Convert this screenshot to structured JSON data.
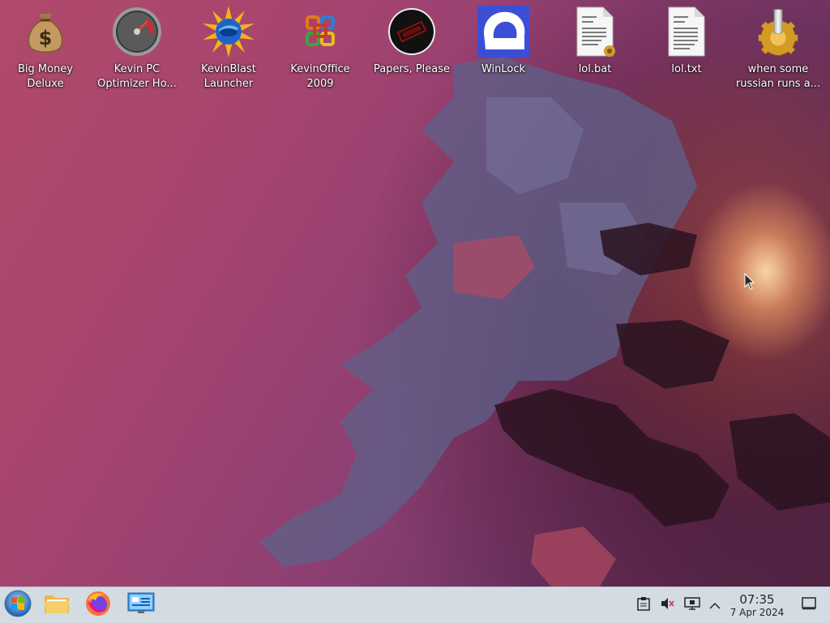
{
  "desktop": {
    "icons": [
      {
        "name": "Big Money Deluxe",
        "label": "Big Money\nDeluxe",
        "icon": "money-bag-icon"
      },
      {
        "name": "Kevin PC Optimizer Home",
        "label": "Kevin PC\nOptimizer Ho...",
        "icon": "speedometer-icon"
      },
      {
        "name": "KevinBlast Launcher",
        "label": "KevinBlast\nLauncher",
        "icon": "globe-burst-icon"
      },
      {
        "name": "KevinOffice 2009",
        "label": "KevinOffice\n2009",
        "icon": "office-logo-icon"
      },
      {
        "name": "Papers, Please",
        "label": "Papers, Please",
        "icon": "stamp-seal-icon"
      },
      {
        "name": "WinLock",
        "label": "WinLock",
        "icon": "winlock-icon"
      },
      {
        "name": "lol.bat",
        "label": "lol.bat",
        "icon": "batch-file-icon"
      },
      {
        "name": "lol.txt",
        "label": "lol.txt",
        "icon": "text-file-icon"
      },
      {
        "name": "when some russian runs a...",
        "label": "when some\nrussian runs a...",
        "icon": "gear-icon"
      }
    ]
  },
  "taskbar": {
    "launchers": [
      {
        "name": "Start",
        "icon": "start-orb-icon"
      },
      {
        "name": "File Manager",
        "icon": "folder-icon"
      },
      {
        "name": "Firefox",
        "icon": "firefox-icon"
      },
      {
        "name": "Remote Desktop",
        "icon": "monitor-app-icon"
      }
    ],
    "tray": [
      {
        "name": "Clipboard",
        "icon": "clipboard-icon"
      },
      {
        "name": "Volume (muted)",
        "icon": "speaker-muted-icon"
      },
      {
        "name": "Display",
        "icon": "display-icon"
      },
      {
        "name": "Show hidden icons",
        "icon": "chevron-up-icon"
      }
    ],
    "clock": {
      "time": "07:35",
      "date": "7 Apr 2024"
    },
    "show_desktop": {
      "icon": "show-desktop-icon"
    }
  }
}
